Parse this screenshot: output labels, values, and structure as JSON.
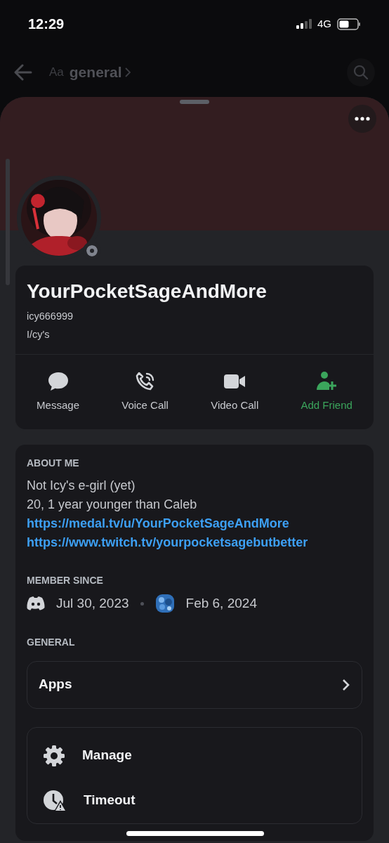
{
  "status_bar": {
    "time": "12:29",
    "network": "4G"
  },
  "channel_header": {
    "icon_text": "Aa",
    "title": "general"
  },
  "profile": {
    "display_name": "YourPocketSageAndMore",
    "username": "icy666999",
    "pronouns": "I/cy's",
    "online": false
  },
  "actions": [
    {
      "kind": "message",
      "label": "Message"
    },
    {
      "kind": "voice",
      "label": "Voice Call"
    },
    {
      "kind": "video",
      "label": "Video Call"
    },
    {
      "kind": "add_friend",
      "label": "Add Friend"
    }
  ],
  "about_me": {
    "heading": "ABOUT ME",
    "lines": [
      {
        "kind": "text",
        "text": "Not Icy's e-girl (yet)"
      },
      {
        "kind": "text",
        "text": "20, 1 year younger than Caleb"
      },
      {
        "kind": "link",
        "text": "https://medal.tv/u/YourPocketSageAndMore"
      },
      {
        "kind": "link",
        "text": "https://www.twitch.tv/yourpocketsagebutbetter"
      }
    ]
  },
  "member_since": {
    "heading": "MEMBER SINCE",
    "entries": [
      {
        "kind": "discord",
        "date": "Jul 30, 2023"
      },
      {
        "kind": "server",
        "date": "Feb 6, 2024"
      }
    ]
  },
  "general": {
    "heading": "GENERAL",
    "items": [
      {
        "label": "Apps"
      }
    ]
  },
  "menu": [
    {
      "kind": "manage",
      "label": "Manage"
    },
    {
      "kind": "timeout",
      "label": "Timeout"
    }
  ]
}
